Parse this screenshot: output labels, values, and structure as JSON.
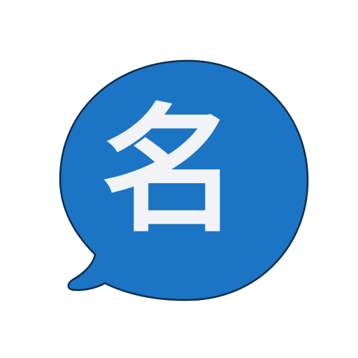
{
  "icon": {
    "name": "chat-bubble-name-icon",
    "glyph": "名",
    "colors": {
      "tile": "#ffffff",
      "bubble": "#1b74c4",
      "bubble_outline": "#0b2d4d",
      "glyph": "#f1f3f6"
    }
  }
}
